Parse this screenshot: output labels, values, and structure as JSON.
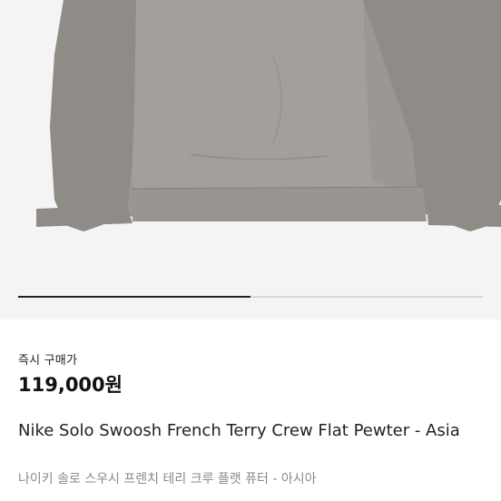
{
  "carousel": {
    "product_image_alt": "Nike Solo Swoosh French Terry Crew Flat Pewter",
    "progress_fraction": 0.5
  },
  "purchase": {
    "label": "즉시 구매가",
    "price": "119,000원"
  },
  "product": {
    "title": "Nike Solo Swoosh French Terry Crew Flat Pewter - Asia",
    "title_translated": "나이키 솔로 스우시 프렌치 테리 크루 플랫 퓨터 - 아시아"
  },
  "colors": {
    "hero_bg": "#f4f4f4",
    "garment": "#9b9893",
    "progress_fill": "#222222",
    "progress_track": "#d9d9d9"
  }
}
